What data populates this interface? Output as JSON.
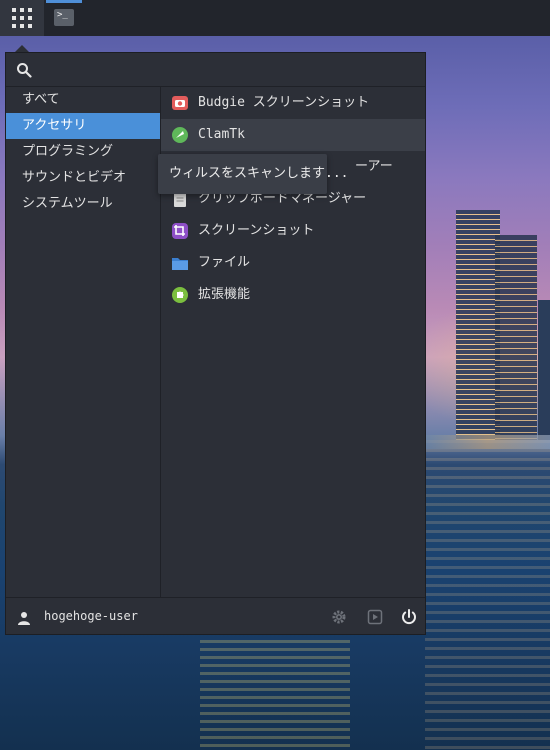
{
  "panel": {
    "apps_button_icon": "grid-icon",
    "running_apps": [
      {
        "icon": "terminal-icon",
        "glyph": ">_"
      }
    ]
  },
  "menu": {
    "search": {
      "placeholder": "",
      "value": ""
    },
    "categories": [
      {
        "label": "すべて",
        "active": false
      },
      {
        "label": "アクセサリ",
        "active": true
      },
      {
        "label": "プログラミング",
        "active": false
      },
      {
        "label": "サウンドとビデオ",
        "active": false
      },
      {
        "label": "システムツール",
        "active": false
      }
    ],
    "apps": [
      {
        "label": "Budgie スクリーンショット",
        "icon": "budgie-screenshot-icon"
      },
      {
        "label": "ClamTk",
        "icon": "clamtk-icon",
        "hovered": true
      },
      {
        "label": "ーアー",
        "icon": "hidden-app-icon"
      },
      {
        "label": "クリップボードマネージャー",
        "icon": "clipboard-icon"
      },
      {
        "label": "スクリーンショット",
        "icon": "screenshot-icon"
      },
      {
        "label": "ファイル",
        "icon": "folder-icon"
      },
      {
        "label": "拡張機能",
        "icon": "extensions-icon"
      }
    ],
    "tooltip": "ウィルスをスキャンします...",
    "footer": {
      "user_name": "hogehoge-user",
      "buttons": [
        "settings-icon",
        "lock-icon",
        "power-icon"
      ]
    }
  },
  "colors": {
    "accent": "#4a90d9",
    "menu_bg": "#2c2f37",
    "panel_bg": "#22252c"
  }
}
